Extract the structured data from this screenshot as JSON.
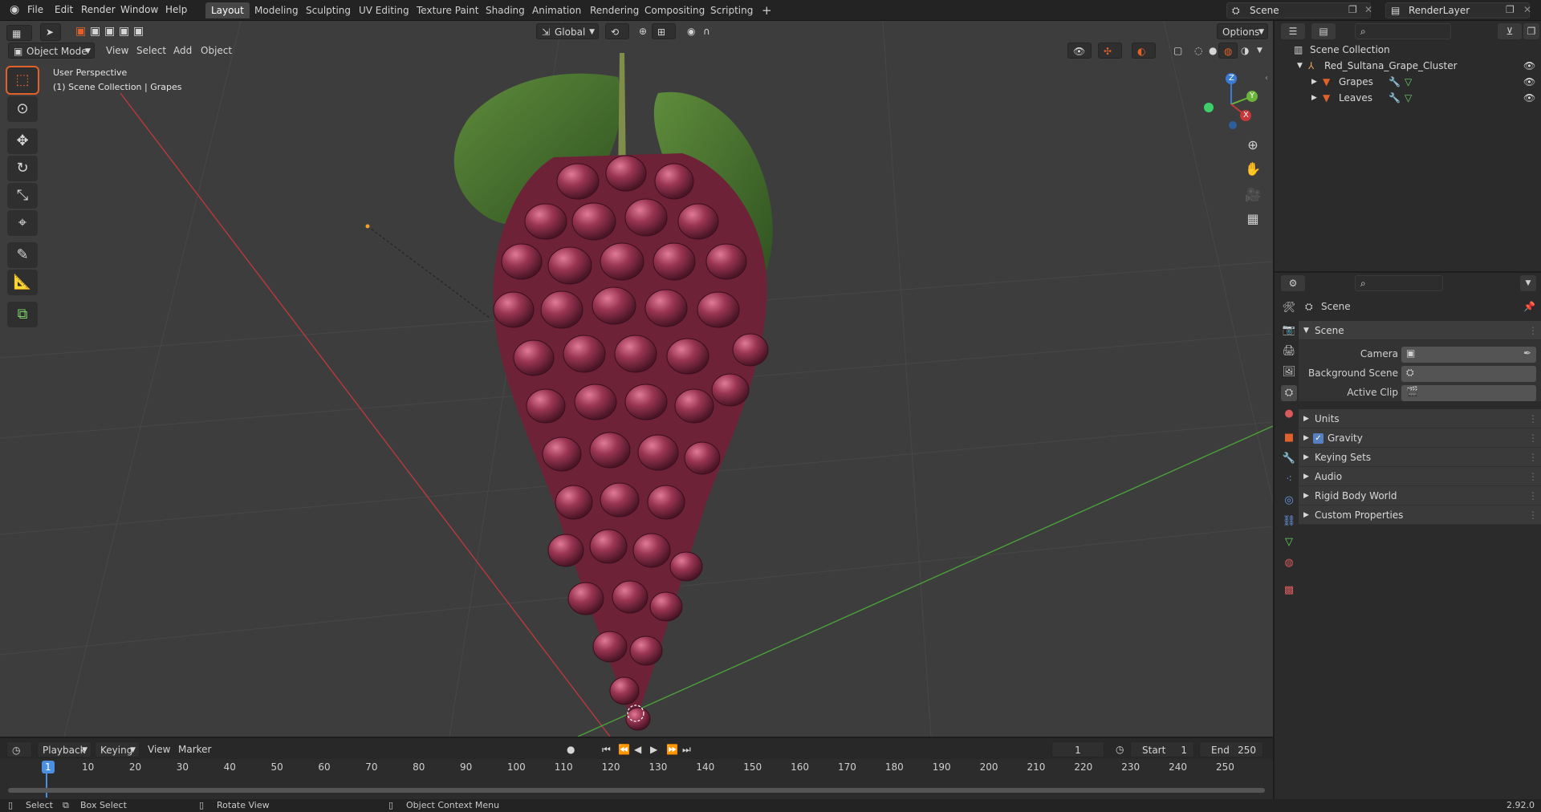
{
  "top_menu": {
    "items": [
      "File",
      "Edit",
      "Render",
      "Window",
      "Help"
    ]
  },
  "workspace_tabs": [
    "Layout",
    "Modeling",
    "Sculpting",
    "UV Editing",
    "Texture Paint",
    "Shading",
    "Animation",
    "Rendering",
    "Compositing",
    "Scripting"
  ],
  "active_tab_index": 0,
  "scene_field": "Scene",
  "render_layer_field": "RenderLayer",
  "viewport": {
    "mode": "Object Mode",
    "header_menus": [
      "View",
      "Select",
      "Add",
      "Object"
    ],
    "transform_orientation": "Global",
    "options_label": "Options",
    "overlay_line1": "User Perspective",
    "overlay_line2": "(1) Scene Collection | Grapes",
    "gizmo": {
      "x": "X",
      "y": "Y",
      "z": "Z"
    }
  },
  "outliner": {
    "root": "Scene Collection",
    "collection": "Red_Sultana_Grape_Cluster",
    "items": [
      "Grapes",
      "Leaves"
    ]
  },
  "properties": {
    "context": "Scene",
    "panel_title": "Scene",
    "fields": [
      {
        "label": "Camera"
      },
      {
        "label": "Background Scene"
      },
      {
        "label": "Active Clip"
      }
    ],
    "sections": [
      "Units",
      "Gravity",
      "Keying Sets",
      "Audio",
      "Rigid Body World",
      "Custom Properties"
    ],
    "gravity_checked": true
  },
  "timeline": {
    "menus": [
      "Playback",
      "Keying",
      "View",
      "Marker"
    ],
    "current_frame": "1",
    "start_label": "Start",
    "start_value": "1",
    "end_label": "End",
    "end_value": "250",
    "ruler": [
      "1",
      "10",
      "20",
      "30",
      "40",
      "50",
      "60",
      "70",
      "80",
      "90",
      "100",
      "110",
      "120",
      "130",
      "140",
      "150",
      "160",
      "170",
      "180",
      "190",
      "200",
      "210",
      "220",
      "230",
      "240",
      "250"
    ]
  },
  "status_bar": {
    "select": "Select",
    "box_select": "Box Select",
    "rotate_view": "Rotate View",
    "context_menu": "Object Context Menu",
    "version": "2.92.0"
  },
  "colors": {
    "accent": "#5680c2",
    "active_tool": "#e0622a",
    "x_axis": "#c8383a",
    "y_axis": "#6bb33a",
    "grape": "#8f2b46"
  }
}
